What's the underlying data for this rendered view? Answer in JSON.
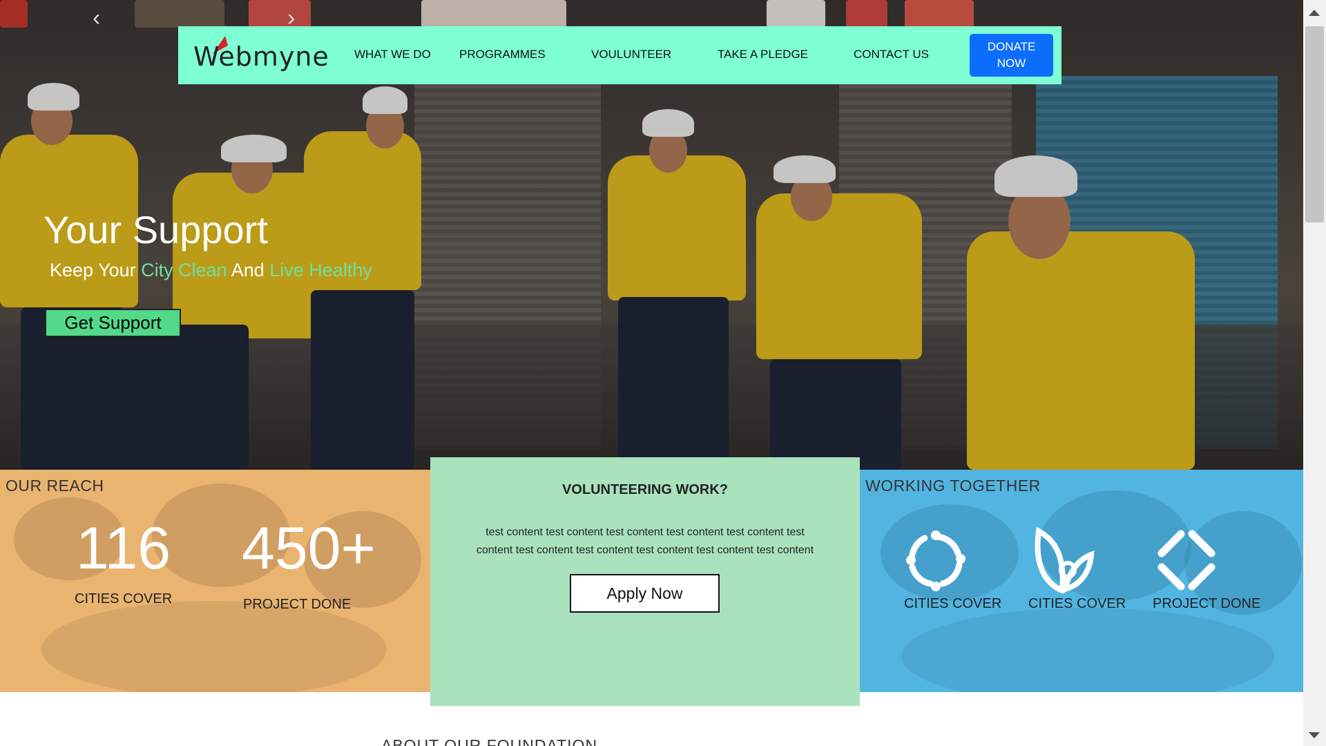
{
  "nav": {
    "logo_text": "Webmyne",
    "items": [
      "WHAT WE DO",
      "PROGRAMMES",
      "VOULUNTEER",
      "TAKE A PLEDGE",
      "CONTACT US"
    ],
    "donate_line1": "DONATE",
    "donate_line2": "NOW"
  },
  "hero": {
    "title": "Your Support",
    "subtitle_1": "Keep Your ",
    "subtitle_2": "City Clean",
    "subtitle_3": " And ",
    "subtitle_4": "Live Healthy",
    "cta": "Get Support",
    "accent_color": "#6fe0a1"
  },
  "reach": {
    "title": "OUR REACH",
    "stats": [
      {
        "value": "116",
        "label": "CITIES COVER"
      },
      {
        "value": "450+",
        "label": "PROJECT DONE"
      }
    ]
  },
  "volunteering": {
    "title": "VOLUNTEERING WORK?",
    "text_line1": "test content test content test content test content test content test",
    "text_line2": "content test content test content test content test content test content",
    "button": "Apply Now"
  },
  "working": {
    "title": "WORKING TOGETHER",
    "items": [
      {
        "icon": "circle-people-icon",
        "label": "CITIES COVER"
      },
      {
        "icon": "leaf-icon",
        "label": "CITIES COVER"
      },
      {
        "icon": "linked-diamond-icon",
        "label": "PROJECT DONE"
      }
    ]
  },
  "about": {
    "title": "ABOUT OUR FOUNDATION"
  },
  "colors": {
    "nav_bg": "#7fffd4",
    "donate_bg": "#0d6efd",
    "reach_bg": "#e9b370",
    "volunteer_bg": "#a9e2bd",
    "working_bg": "#52b4e0"
  }
}
